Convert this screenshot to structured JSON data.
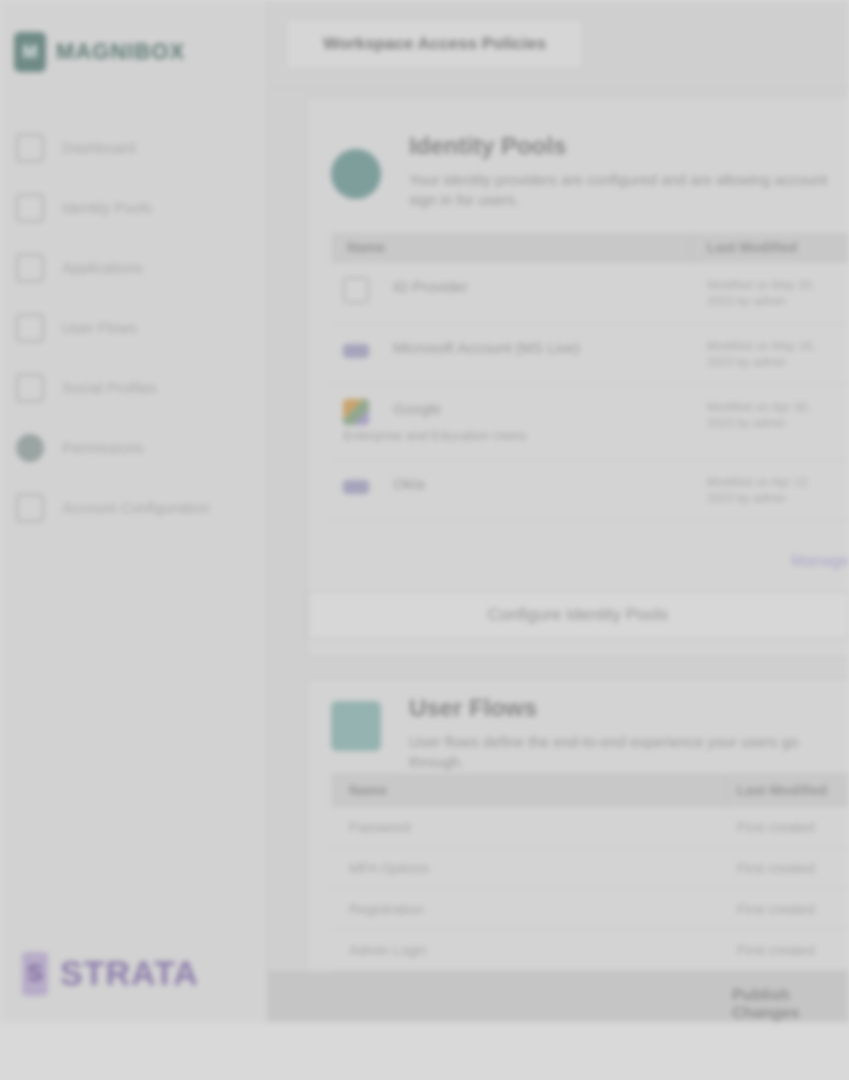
{
  "app": {
    "brand_name": "MAGNIBOX",
    "footer_brand": "STRATA",
    "breadcrumb_title": "Workspace Access Policies"
  },
  "sidebar": {
    "items": [
      {
        "label": "Dashboard",
        "icon": "grid-icon"
      },
      {
        "label": "Identity Pools",
        "icon": "id-icon"
      },
      {
        "label": "Applications",
        "icon": "apps-icon"
      },
      {
        "label": "User Flows",
        "icon": "flow-icon"
      },
      {
        "label": "Social Profiles",
        "icon": "profile-icon"
      },
      {
        "label": "Permissions",
        "icon": "shield-icon"
      },
      {
        "label": "Account Configuration",
        "icon": "settings-icon"
      }
    ]
  },
  "identity_section": {
    "title": "Identity Pools",
    "description": "Your identity providers are configured and are allowing account sign in for users.",
    "columns": [
      "Name",
      "Last Modified"
    ],
    "rows": [
      {
        "name": "ID Provider",
        "sub": "",
        "modified": "Modified on May 20, 2023 by admin",
        "icon": "id-card-icon"
      },
      {
        "name": "Microsoft Account (MS Live)",
        "sub": "",
        "modified": "Modified on May 18, 2023 by admin",
        "icon": "microsoft-icon"
      },
      {
        "name": "Google",
        "sub": "Enterprise and Education Users",
        "modified": "Modified on Apr 30, 2023 by admin",
        "icon": "google-icon"
      },
      {
        "name": "Okta",
        "sub": "",
        "modified": "Modified on Apr 12, 2023 by admin",
        "icon": "okta-icon"
      }
    ],
    "more_link": "Manage",
    "config_button": "Configure Identity Pools"
  },
  "user_flows_section": {
    "title": "User Flows",
    "description": "User flows define the end-to-end experience your users go through.",
    "columns": [
      "Name",
      "Last Modified"
    ],
    "rows": [
      {
        "name": "Password",
        "modified": "First created"
      },
      {
        "name": "MFA Options",
        "modified": "First created"
      },
      {
        "name": "Registration",
        "modified": "First created"
      },
      {
        "name": "Admin Login",
        "modified": "First created"
      }
    ]
  },
  "footer_bar": {
    "button_label": "Publish Changes"
  }
}
